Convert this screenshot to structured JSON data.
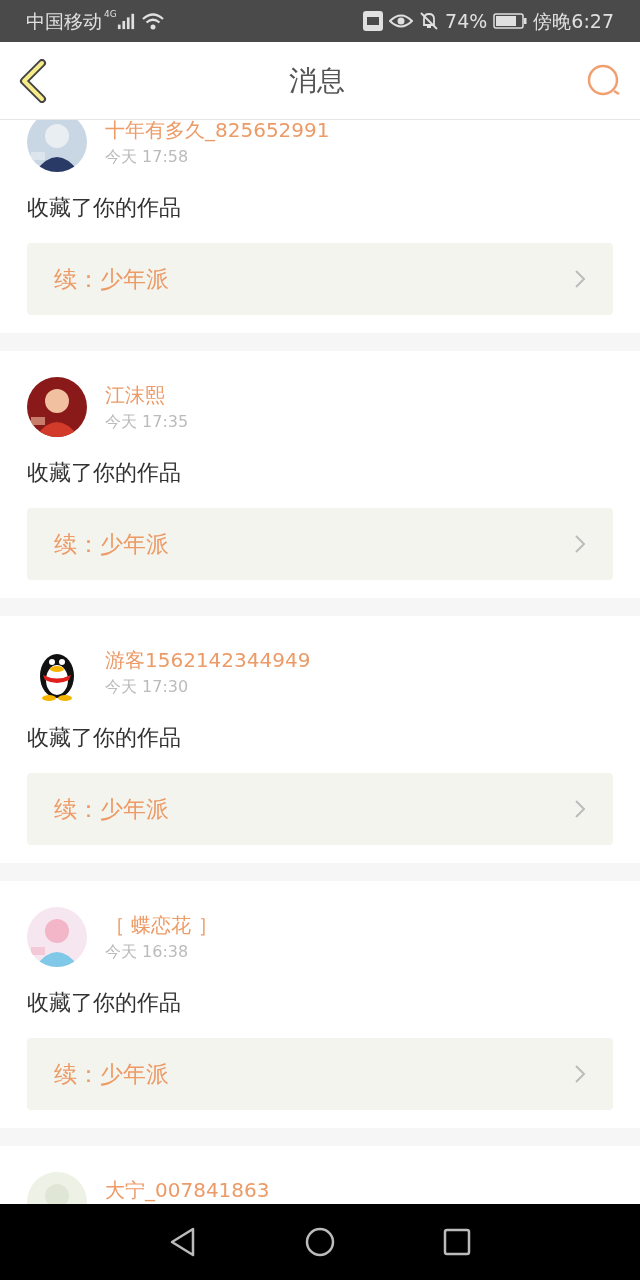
{
  "status_bar": {
    "carrier": "中国移动",
    "network": "4G",
    "battery": "74%",
    "time": "傍晚6:27"
  },
  "header": {
    "title": "消息"
  },
  "messages": [
    {
      "user": "十年有多久_825652991",
      "time": "今天 17:58",
      "text": "收藏了你的作品",
      "work": "续：少年派"
    },
    {
      "user": "江沫熙",
      "time": "今天 17:35",
      "text": "收藏了你的作品",
      "work": "续：少年派"
    },
    {
      "user": "游客1562142344949",
      "time": "今天 17:30",
      "text": "收藏了你的作品",
      "work": "续：少年派",
      "avatar": {
        "kind": "icon"
      }
    },
    {
      "user": "［ 蝶恋花 ］",
      "time": "今天 16:38",
      "text": "收藏了你的作品",
      "work": "续：少年派"
    },
    {
      "user": "大宁_007841863"
    }
  ]
}
